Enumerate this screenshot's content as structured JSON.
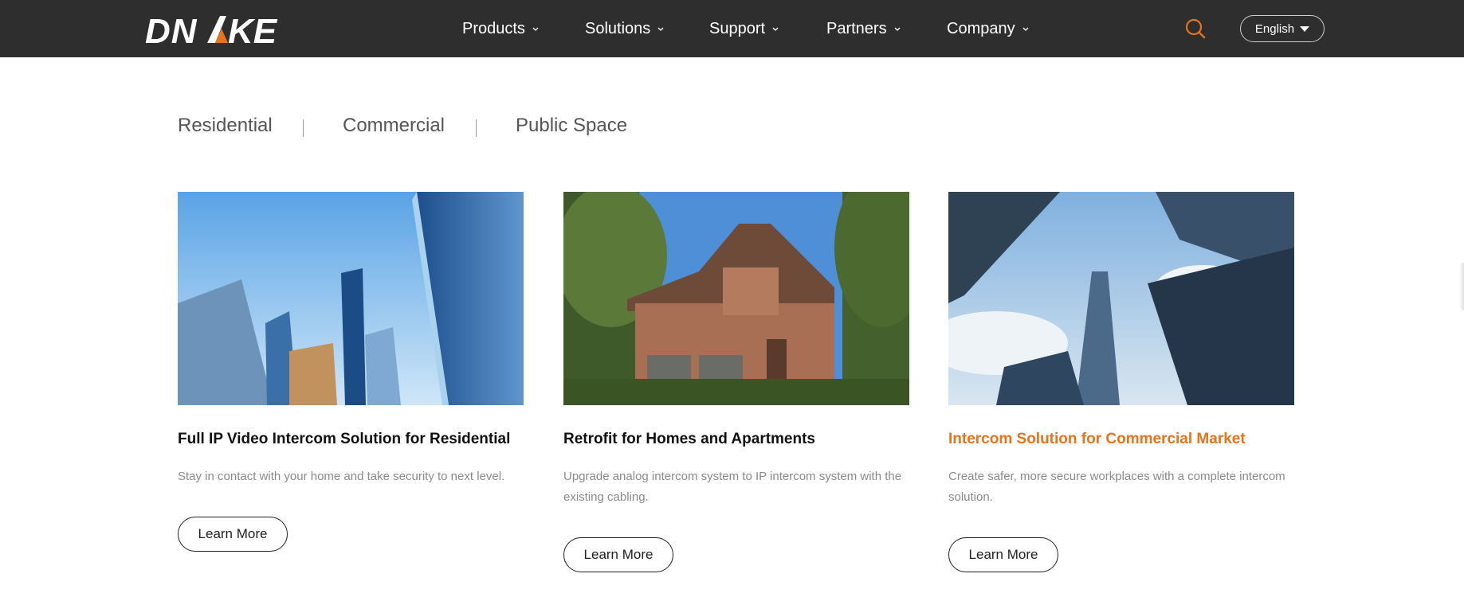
{
  "header": {
    "logo_text": "DNAKE",
    "nav": [
      {
        "label": "Products"
      },
      {
        "label": "Solutions"
      },
      {
        "label": "Support"
      },
      {
        "label": "Partners"
      },
      {
        "label": "Company"
      }
    ],
    "language": "English"
  },
  "tabs": [
    "Residential",
    "Commercial",
    "Public Space"
  ],
  "cards": [
    {
      "title": "Full IP Video Intercom Solution for Residential",
      "description": "Stay in contact with your home and take security to next level.",
      "button": "Learn More"
    },
    {
      "title": "Retrofit for Homes and Apartments",
      "description": "Upgrade analog intercom system to IP intercom system with the existing cabling.",
      "button": "Learn More"
    },
    {
      "title": "Intercom Solution for Commercial Market",
      "description": "Create safer, more secure workplaces with a complete intercom solution.",
      "button": "Learn More"
    }
  ],
  "colors": {
    "header_bg": "#2e2e2e",
    "accent": "#e8731a",
    "text_muted": "#8a8a8a"
  }
}
